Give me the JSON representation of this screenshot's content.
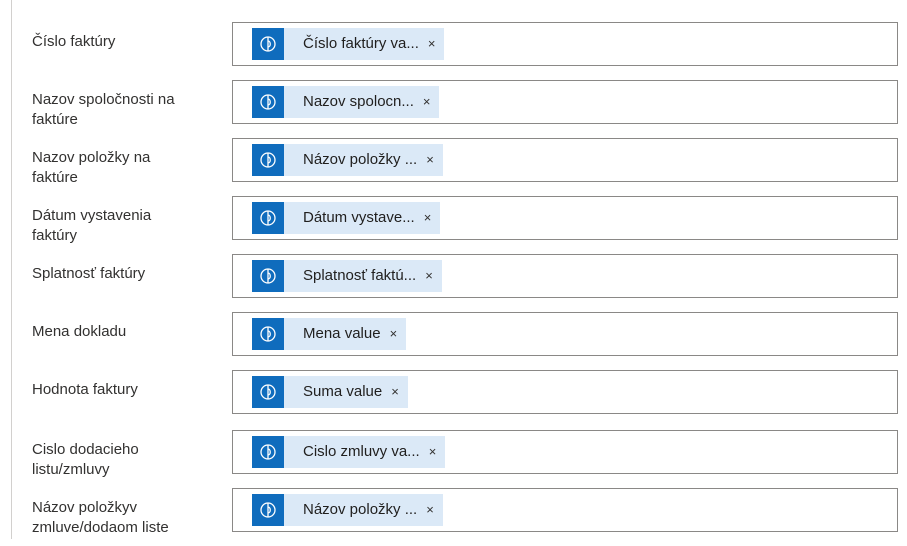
{
  "fields": [
    {
      "label": "Číslo faktúry",
      "token": "Číslo faktúry va...",
      "remove": "×"
    },
    {
      "label": "Nazov spoločnosti na\nfaktúre",
      "token": "Nazov spolocn...",
      "remove": "×"
    },
    {
      "label": "Nazov položky na\nfaktúre",
      "token": "Názov položky ...",
      "remove": "×"
    },
    {
      "label": "Dátum vystavenia\nfaktúry",
      "token": "Dátum vystave...",
      "remove": "×"
    },
    {
      "label": "Splatnosť faktúry",
      "token": "Splatnosť faktú...",
      "remove": "×"
    },
    {
      "label": "Mena dokladu",
      "token": "Mena value",
      "remove": "×"
    },
    {
      "label": "Hodnota faktury",
      "token": "Suma value",
      "remove": "×"
    },
    {
      "label": "Cislo dodacieho\nlistu/zmluvy",
      "token": "Cislo zmluvy va...",
      "remove": "×"
    },
    {
      "label": "Názov položkyv\nzmluve/dodaom liste",
      "token": "Názov položky ...",
      "remove": "×"
    }
  ],
  "token_icon": "ai-builder-icon",
  "colors": {
    "icon_bg": "#0f6cbd",
    "token_bg": "#dbe9f7",
    "field_border": "#8a8886"
  }
}
